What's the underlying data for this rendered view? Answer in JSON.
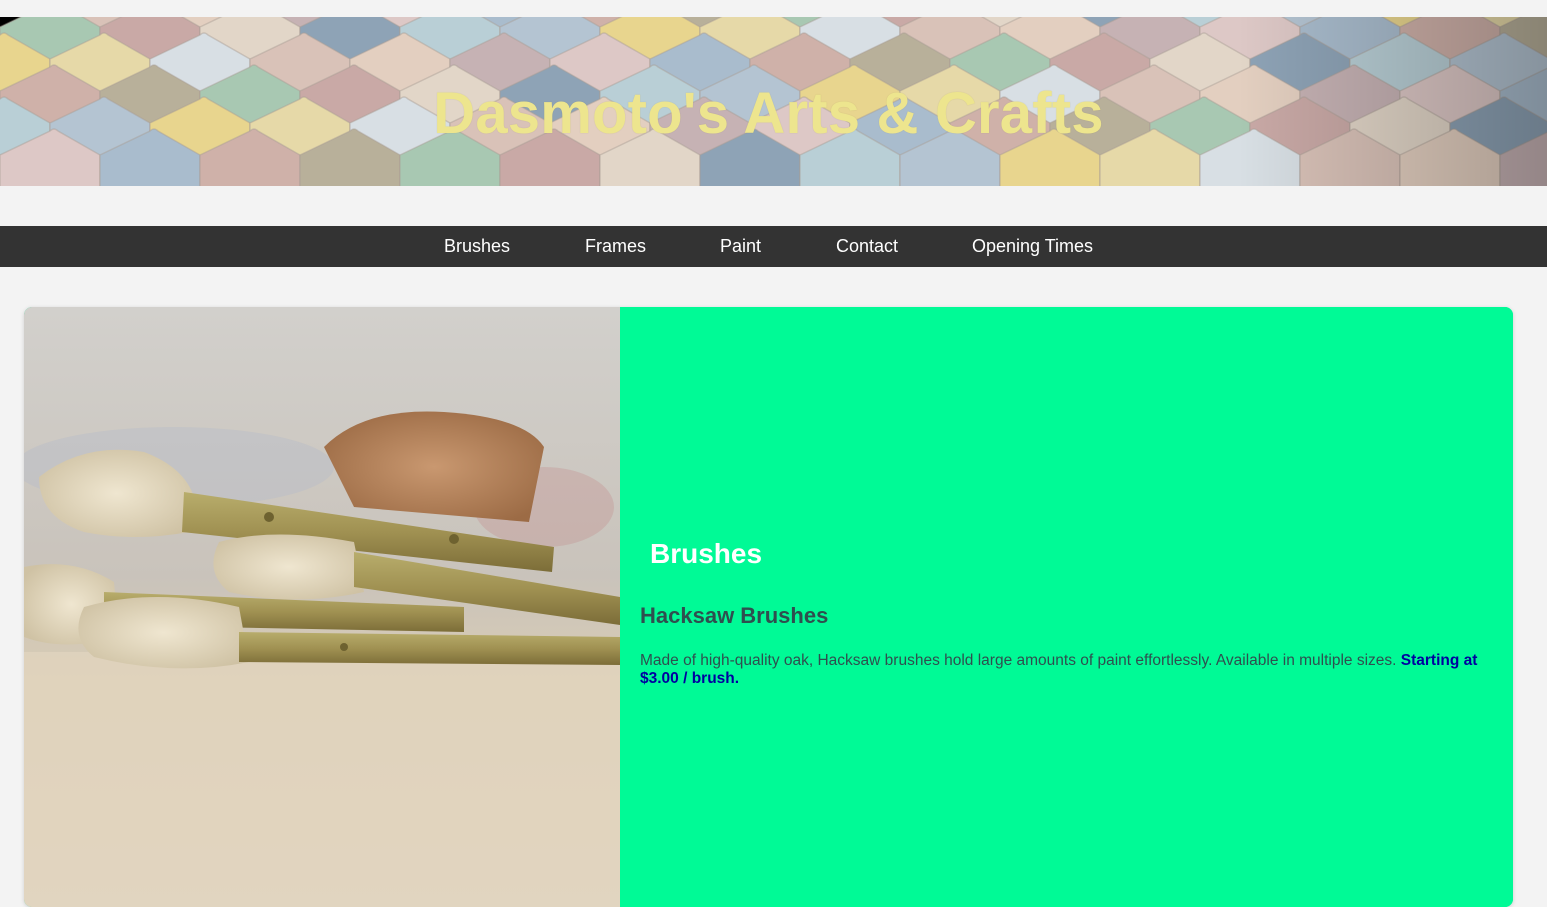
{
  "header": {
    "title": "Dasmoto's Arts & Crafts"
  },
  "nav": {
    "items": [
      {
        "label": "Brushes"
      },
      {
        "label": "Frames"
      },
      {
        "label": "Paint"
      },
      {
        "label": "Contact"
      },
      {
        "label": "Opening Times"
      }
    ]
  },
  "section": {
    "heading": "Brushes",
    "product_title": "Hacksaw Brushes",
    "description": "Made of high-quality oak, Hacksaw brushes hold large amounts of paint effortlessly. Available in multiple sizes.",
    "price": "Starting at $3.00 / brush."
  },
  "colors": {
    "title": "#ede58e",
    "nav_background": "#333333",
    "panel_background": "#00fa96",
    "product_text": "#2f4f4f",
    "price_text": "#0000a0"
  }
}
